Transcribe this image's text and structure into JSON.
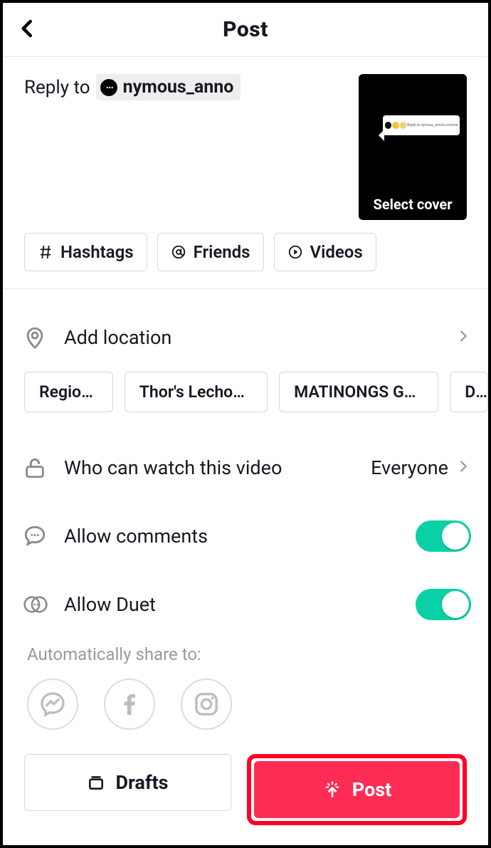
{
  "header": {
    "title": "Post"
  },
  "caption": {
    "reply_prefix": "Reply to",
    "mention": "nymous_anno"
  },
  "cover": {
    "label": "Select cover",
    "overlay_text": "Reply to nymous_anno's comment"
  },
  "chips": {
    "hashtags": "Hashtags",
    "friends": "Friends",
    "videos": "Videos"
  },
  "location": {
    "label": "Add location",
    "suggestions": [
      "Region XII",
      "Thor's Lechon Hauz",
      "MATINONGS GARDE...",
      "D"
    ]
  },
  "privacy": {
    "label": "Who can watch this video",
    "value": "Everyone"
  },
  "comments": {
    "label": "Allow comments",
    "on": true
  },
  "duet": {
    "label": "Allow Duet",
    "on": true
  },
  "share": {
    "label": "Automatically share to:"
  },
  "footer": {
    "drafts": "Drafts",
    "post": "Post"
  }
}
